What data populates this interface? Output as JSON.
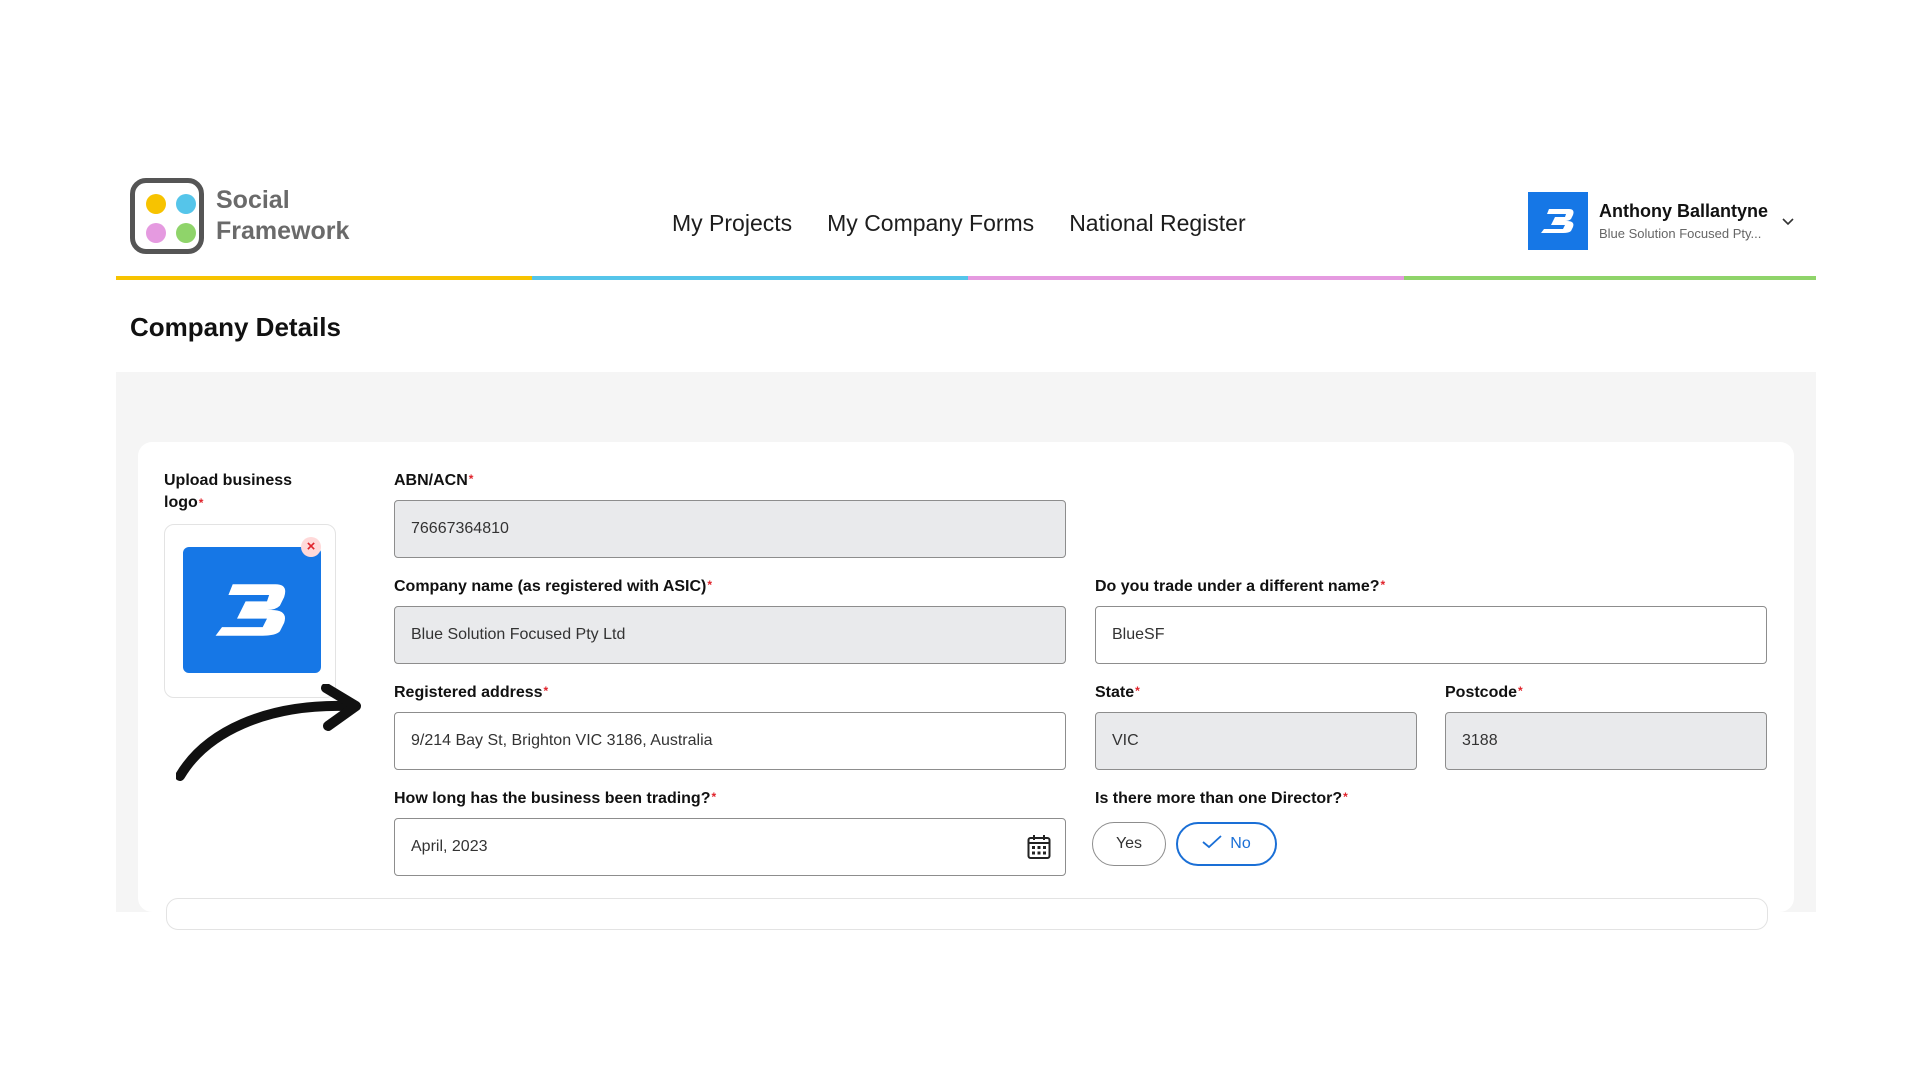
{
  "header": {
    "brand_line1": "Social",
    "brand_line2": "Framework",
    "nav": [
      "My Projects",
      "My Company Forms",
      "National Register"
    ],
    "user_name": "Anthony Ballantyne",
    "user_company": "Blue Solution Focused Pty...",
    "colors": [
      "#f7c300",
      "#55c5ea",
      "#e59ae0",
      "#8fd46a"
    ]
  },
  "page": {
    "title": "Company Details"
  },
  "form": {
    "upload_label": "Upload business logo",
    "abn_label": "ABN/ACN",
    "abn_value": "76667364810",
    "company_name_label": "Company name (as registered with ASIC)",
    "company_name_value": "Blue Solution Focused Pty Ltd",
    "trade_name_label": "Do you trade under a different name?",
    "trade_name_value": "BlueSF",
    "address_label": "Registered address",
    "address_value": "9/214 Bay St, Brighton VIC 3186, Australia",
    "state_label": "State",
    "state_value": "VIC",
    "postcode_label": "Postcode",
    "postcode_value": "3188",
    "trading_label": "How long has the business been trading?",
    "trading_value": "April, 2023",
    "director_label": "Is there more than one Director?",
    "director_yes": "Yes",
    "director_no": "No",
    "director_selected": "No",
    "required_marker": "*"
  },
  "icons": {
    "logo_brand": "social-framework-logo",
    "company_logo": "blue-b-logo",
    "remove": "close-icon",
    "calendar": "calendar-icon",
    "check": "check-icon",
    "chevron": "chevron-down-icon",
    "annotation": "curved-arrow-icon"
  },
  "accent_colors": {
    "primary_blue": "#1677e6",
    "selection_blue": "#1a6fd6",
    "required_red": "#e0232b"
  }
}
